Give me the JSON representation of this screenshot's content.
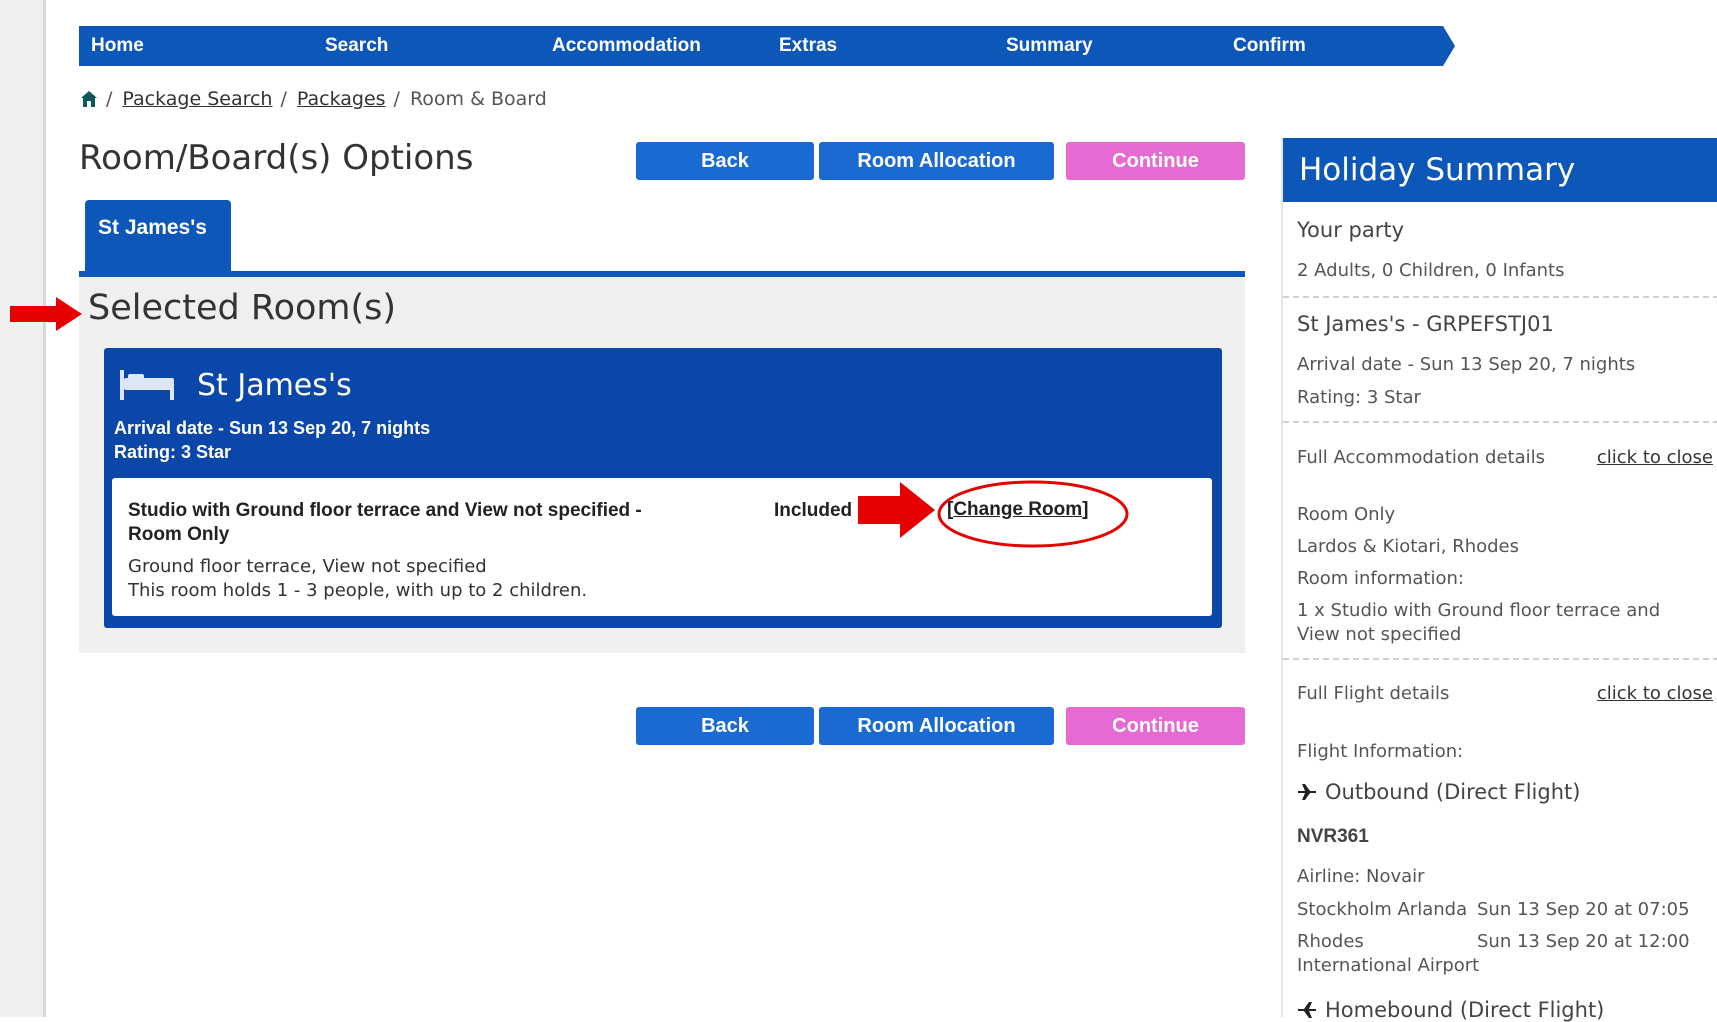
{
  "steps": [
    "Home",
    "Search",
    "Accommodation",
    "Extras",
    "Summary",
    "Confirm"
  ],
  "breadcrumb": {
    "items": [
      {
        "label": "Package Search"
      },
      {
        "label": "Packages"
      },
      {
        "label": "Room & Board"
      }
    ]
  },
  "page_title": "Room/Board(s) Options",
  "buttons": {
    "back": "Back",
    "room_allocation": "Room Allocation",
    "continue": "Continue"
  },
  "tab_label": "St James's",
  "section_title": "Selected Room(s)",
  "hotel": {
    "name": "St James's",
    "arrival": "Arrival date - Sun 13 Sep 20, 7 nights",
    "rating": "Rating: 3 Star"
  },
  "room": {
    "title": "Studio with Ground floor terrace and View not specified -",
    "included": "Included",
    "board": "Room Only",
    "features": "Ground floor terrace, View not specified",
    "capacity": "This room holds 1 - 3 people, with up to 2 children.",
    "change_link": "Change Room",
    "change_open": "[",
    "change_close": "]"
  },
  "summary": {
    "title": "Holiday Summary",
    "party_label": "Your party",
    "party_value": "2 Adults, 0 Children, 0 Infants",
    "hotel_code": "St James's - GRPEFSTJ01",
    "arrival": "Arrival date - Sun 13 Sep 20, 7 nights",
    "rating": "Rating: 3 Star",
    "accommodation_details_label": "Full Accommodation details",
    "close_link": "click to close",
    "board": "Room Only",
    "location": "Lardos & Kiotari, Rhodes",
    "room_info_label": "Room information:",
    "room_info_line1": "1 x Studio with Ground floor terrace and",
    "room_info_line2": "View not specified",
    "flight_details_label": "Full Flight details",
    "flight_info_label": "Flight Information:",
    "outbound_label": "Outbound (Direct Flight)",
    "flight_number": "NVR361",
    "airline": "Airline:  Novair",
    "dep_airport": "Stockholm Arlanda",
    "dep_time": "Sun 13 Sep 20 at 07:05",
    "arr_airport_line1": "Rhodes",
    "arr_airport_line2": "International Airport",
    "arr_time": "Sun 13 Sep 20 at 12:00",
    "homebound_label": "Homebound (Direct Flight)"
  },
  "colors": {
    "primary_blue": "#0d57b8",
    "button_blue": "#1a6ad2",
    "continue_pink": "#e56bd3",
    "annotation_red": "#e60000"
  }
}
